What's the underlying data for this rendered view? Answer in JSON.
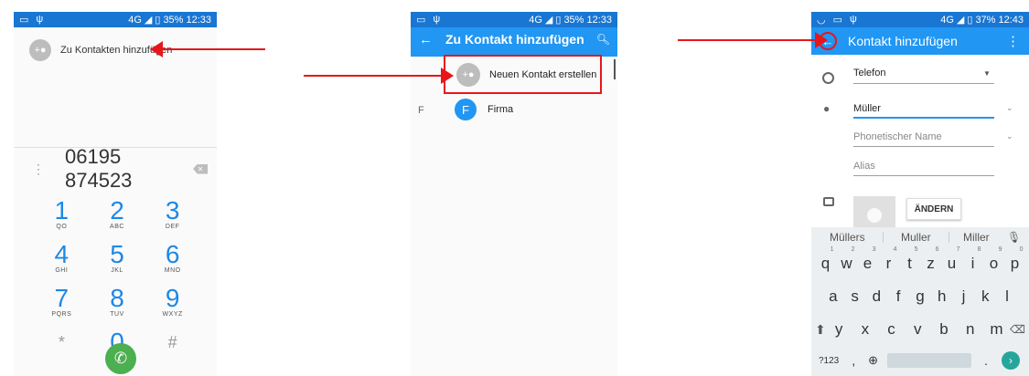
{
  "screen1": {
    "status": {
      "net": "4G",
      "battery": "35%",
      "time": "12:33"
    },
    "add_to_contacts_label": "Zu Kontakten hinzufügen",
    "dial_number": "06195 874523",
    "keys": [
      {
        "digit": "1",
        "letters": "QO"
      },
      {
        "digit": "2",
        "letters": "ABC"
      },
      {
        "digit": "3",
        "letters": "DEF"
      },
      {
        "digit": "4",
        "letters": "GHI"
      },
      {
        "digit": "5",
        "letters": "JKL"
      },
      {
        "digit": "6",
        "letters": "MNO"
      },
      {
        "digit": "7",
        "letters": "PQRS"
      },
      {
        "digit": "8",
        "letters": "TUV"
      },
      {
        "digit": "9",
        "letters": "WXYZ"
      },
      {
        "digit": "*",
        "letters": ""
      },
      {
        "digit": "0",
        "letters": "+"
      },
      {
        "digit": "#",
        "letters": ""
      }
    ]
  },
  "screen2": {
    "status": {
      "net": "4G",
      "battery": "35%",
      "time": "12:33"
    },
    "title": "Zu Kontakt hinzufügen",
    "new_contact_label": "Neuen Kontakt erstellen",
    "section_letter": "F",
    "contact_initial": "F",
    "contact_name": "Firma"
  },
  "screen3": {
    "status": {
      "net": "4G",
      "battery": "37%",
      "time": "12:43"
    },
    "title": "Kontakt hinzufügen",
    "account_value": "Telefon",
    "name_value": "Müller",
    "phonetic_placeholder": "Phonetischer Name",
    "alias_placeholder": "Alias",
    "change_photo_label": "ÄNDERN",
    "suggestions": [
      "Müllers",
      "Muller",
      "Miller"
    ],
    "keyboard": {
      "row1": [
        "q",
        "w",
        "e",
        "r",
        "t",
        "z",
        "u",
        "i",
        "o",
        "p"
      ],
      "row1_hints": [
        "1",
        "2",
        "3",
        "4",
        "5",
        "6",
        "7",
        "8",
        "9",
        "0"
      ],
      "row2": [
        "a",
        "s",
        "d",
        "f",
        "g",
        "h",
        "j",
        "k",
        "l"
      ],
      "row3": [
        "y",
        "x",
        "c",
        "v",
        "b",
        "n",
        "m"
      ],
      "symbols_label": "?123",
      "comma": ",",
      "period": "."
    }
  },
  "colors": {
    "app_blue": "#2196f3",
    "status_blue": "#1976d2",
    "call_green": "#4caf50",
    "arrow_red": "#e8161b",
    "dial_blue": "#1e88e5"
  }
}
